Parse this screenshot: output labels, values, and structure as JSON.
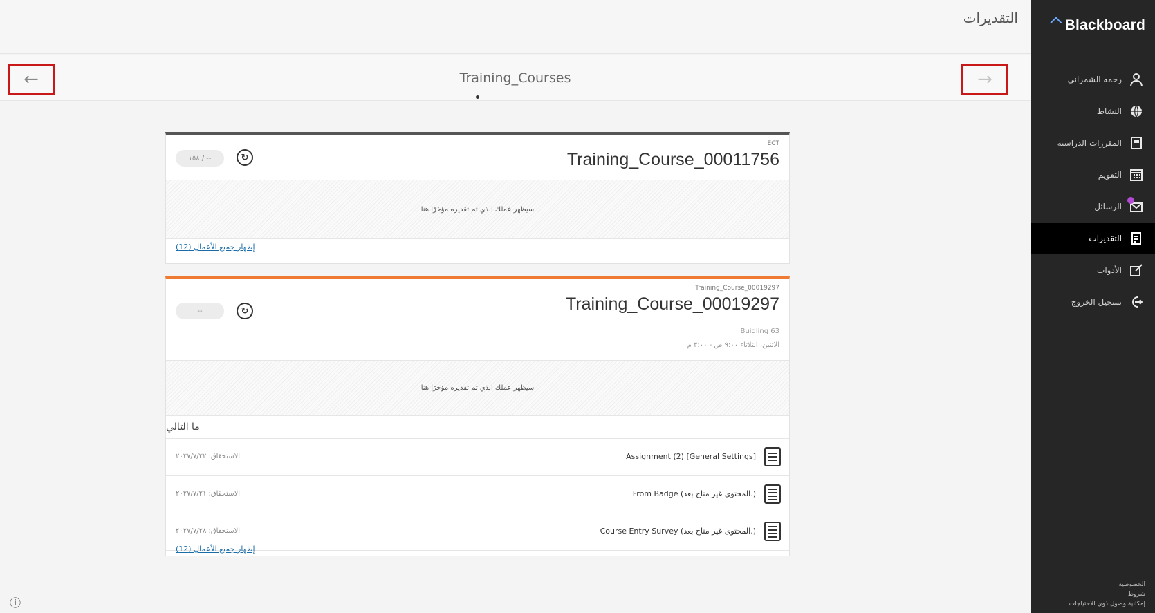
{
  "sidebar": {
    "brand": "Blackboard",
    "items": [
      {
        "label": "رحمه الشمراني",
        "icon": "user-icon"
      },
      {
        "label": "النشاط",
        "icon": "globe-icon"
      },
      {
        "label": "المقررات الدراسية",
        "icon": "book-icon"
      },
      {
        "label": "التقويم",
        "icon": "calendar-icon"
      },
      {
        "label": "الرسائل",
        "icon": "mail-icon"
      },
      {
        "label": "التقديرات",
        "icon": "grades-icon"
      },
      {
        "label": "الأدوات",
        "icon": "tools-icon"
      },
      {
        "label": "تسجيل الخروج",
        "icon": "sign-out-icon"
      }
    ],
    "footer": [
      "الخصوصية",
      "شروط",
      "إمكانية وصول ذوي الاحتياجات"
    ]
  },
  "header": {
    "title": "التقديرات"
  },
  "course_nav": {
    "title": "Training_Courses"
  },
  "cards": [
    {
      "code": "ECT",
      "title": "Training_Course_00011756",
      "grade": "١٥٨ / --",
      "empty_text": "سيظهر عملك الذي تم تقديره مؤخرًا هنا",
      "show_all": "إظهار جميع الأعمال (12)"
    },
    {
      "code": "Training_Course_00019297",
      "title": "Training_Course_00019297",
      "location": "Buidling 63",
      "schedule": "الاثنين، الثلاثاء ٩:٠٠ ص - ٣:٠٠ م",
      "grade": "--",
      "empty_text": "سيظهر عملك الذي تم تقديره مؤخرًا هنا",
      "next_heading": "ما التالي",
      "next_items": [
        {
          "title": "Assignment (2) [General Settings]",
          "due": "الاستحقاق: ٢٠٢٧/٧/٢٢"
        },
        {
          "title": "From Badge (المحتوى غير متاح بعد.)",
          "due": "الاستحقاق: ٢٠٢٧/٧/٢١"
        },
        {
          "title": "Course Entry Survey (المحتوى غير متاح بعد.)",
          "due": "الاستحقاق: ٢٠٢٧/٧/٢٨"
        }
      ],
      "show_all": "إظهار جميع الأعمال (12)"
    }
  ]
}
